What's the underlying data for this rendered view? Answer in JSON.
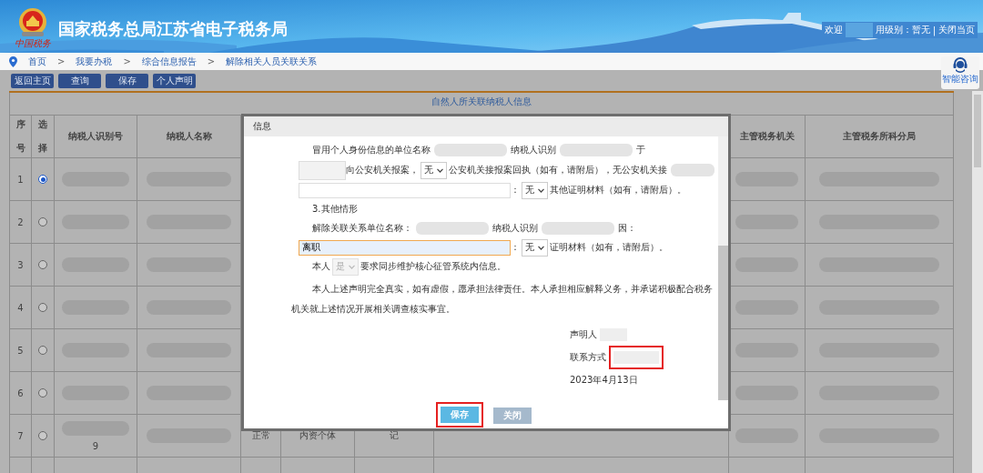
{
  "header": {
    "logo_caption": "中国税务",
    "title": "国家税务总局江苏省电子税务局",
    "welcome": "欢迎",
    "credit": "用级别：暂无",
    "separator": "|",
    "close_link": "关闭当页"
  },
  "breadcrumb": {
    "separator": ">",
    "items": [
      "首页",
      "我要办税",
      "综合信息报告",
      "解除相关人员关联关系"
    ]
  },
  "toolbar": [
    "返回主页",
    "查询",
    "保存",
    "个人声明"
  ],
  "assistant": {
    "label": "智能咨询"
  },
  "table": {
    "title": "自然人所关联纳税人信息",
    "columns": [
      "序号",
      "选择",
      "纳税人识别号",
      "纳税人名称",
      "主管税务机关",
      "主管税务所科分局"
    ],
    "rows": [
      {
        "index": "1",
        "selected": true
      },
      {
        "index": "2",
        "selected": false
      },
      {
        "index": "3",
        "selected": false
      },
      {
        "index": "4",
        "selected": false
      },
      {
        "index": "5",
        "selected": false
      },
      {
        "index": "6",
        "selected": false
      },
      {
        "index": "7",
        "selected": false,
        "taxpayer_id": "9",
        "column_5": "正常",
        "column_6": "内资个体",
        "column_7": "记"
      }
    ]
  },
  "dialog": {
    "title": "信息",
    "lines": [
      {
        "kind": "row",
        "parts": [
          {
            "kind": "text",
            "text": "冒用个人身份信息的单位名称"
          },
          {
            "kind": "redacted"
          },
          {
            "kind": "text",
            "text": "纳税人识别"
          },
          {
            "kind": "redacted"
          },
          {
            "kind": "text",
            "text": "于"
          }
        ]
      },
      {
        "kind": "row",
        "parts": [
          {
            "kind": "input",
            "disabled": true
          },
          {
            "kind": "text",
            "text": "向公安机关报案，"
          },
          {
            "kind": "select",
            "value": "无",
            "disabled": false
          },
          {
            "kind": "text",
            "text": "公安机关接报案回执（如有，请附后），无公安机关接"
          },
          {
            "kind": "redacted"
          }
        ]
      },
      {
        "kind": "row",
        "parts": [
          {
            "kind": "input",
            "disabled": false
          },
          {
            "kind": "text",
            "text": "："
          },
          {
            "kind": "select",
            "value": "无",
            "disabled": false
          },
          {
            "kind": "text",
            "text": "其他证明材料（如有，请附后）。"
          }
        ]
      },
      {
        "kind": "row",
        "parts": [
          {
            "kind": "text",
            "text": "3.其他情形"
          }
        ]
      },
      {
        "kind": "row",
        "parts": [
          {
            "kind": "text",
            "text": "解除关联关系单位名称："
          },
          {
            "kind": "redacted"
          },
          {
            "kind": "text",
            "text": "纳税人识别"
          },
          {
            "kind": "redacted"
          },
          {
            "kind": "text",
            "text": "因："
          }
        ]
      },
      {
        "kind": "row",
        "parts": [
          {
            "kind": "input",
            "disabled": false,
            "focused": true,
            "value": "离职"
          },
          {
            "kind": "text",
            "text": "："
          },
          {
            "kind": "select",
            "value": "无",
            "disabled": false
          },
          {
            "kind": "text",
            "text": "证明材料（如有，请附后）。"
          }
        ]
      },
      {
        "kind": "row",
        "parts": [
          {
            "kind": "text",
            "text": "本人"
          },
          {
            "kind": "select",
            "value": "是",
            "disabled": true
          },
          {
            "kind": "text",
            "text": "要求同步维护核心征管系统内信息。"
          }
        ]
      },
      {
        "kind": "paragraph",
        "text": "本人上述声明完全真实，如有虚假，愿承担法律责任。本人承担相应解释义务，并承诺积极配合税务机关就上述情况开展相关调查核实事宜。"
      }
    ],
    "declarant_label": "声明人",
    "contact_label": "联系方式",
    "contact_highlighted": true,
    "date": "2023年4月13日",
    "buttons": [
      {
        "label": "保存",
        "kind": "primary",
        "highlighted": true
      },
      {
        "label": "关闭",
        "kind": "secondary",
        "highlighted": false
      }
    ]
  }
}
